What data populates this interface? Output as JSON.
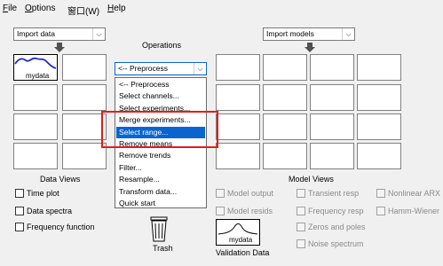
{
  "menu": {
    "file": {
      "mnemonic": "F",
      "rest": "ile"
    },
    "options": {
      "mnemonic": "O",
      "rest": "ptions"
    },
    "window": "窗口(W)",
    "help": {
      "mnemonic": "H",
      "rest": "elp"
    }
  },
  "import_data": "Import data",
  "import_models": "Import models",
  "operations_label": "Operations",
  "preprocess_combo": "<-- Preprocess",
  "mydata_label": "mydata",
  "dropdown_items": [
    "<-- Preprocess",
    "Select channels...",
    "Select experiments...",
    "Merge experiments...",
    "Select range...",
    "Remove means",
    "Remove trends",
    "Filter...",
    "Resample...",
    "Transform data...",
    "Quick start"
  ],
  "dropdown_selected_index": 4,
  "data_views": {
    "title": "Data Views",
    "items": [
      "Time plot",
      "Data spectra",
      "Frequency function"
    ]
  },
  "model_views": {
    "title": "Model Views",
    "col1": [
      "Model output",
      "Model resids"
    ],
    "col2": [
      "Transient resp",
      "Frequency resp",
      "Zeros and poles",
      "Noise spectrum"
    ],
    "col3": [
      "Nonlinear ARX",
      "Hamm-Wiener"
    ]
  },
  "trash_label": "Trash",
  "validation": {
    "label": "Validation Data",
    "item": "mydata"
  },
  "colors": {
    "selection": "#0a64d0",
    "highlight_box": "#e31c1c",
    "curve": "#1f2fbf"
  }
}
